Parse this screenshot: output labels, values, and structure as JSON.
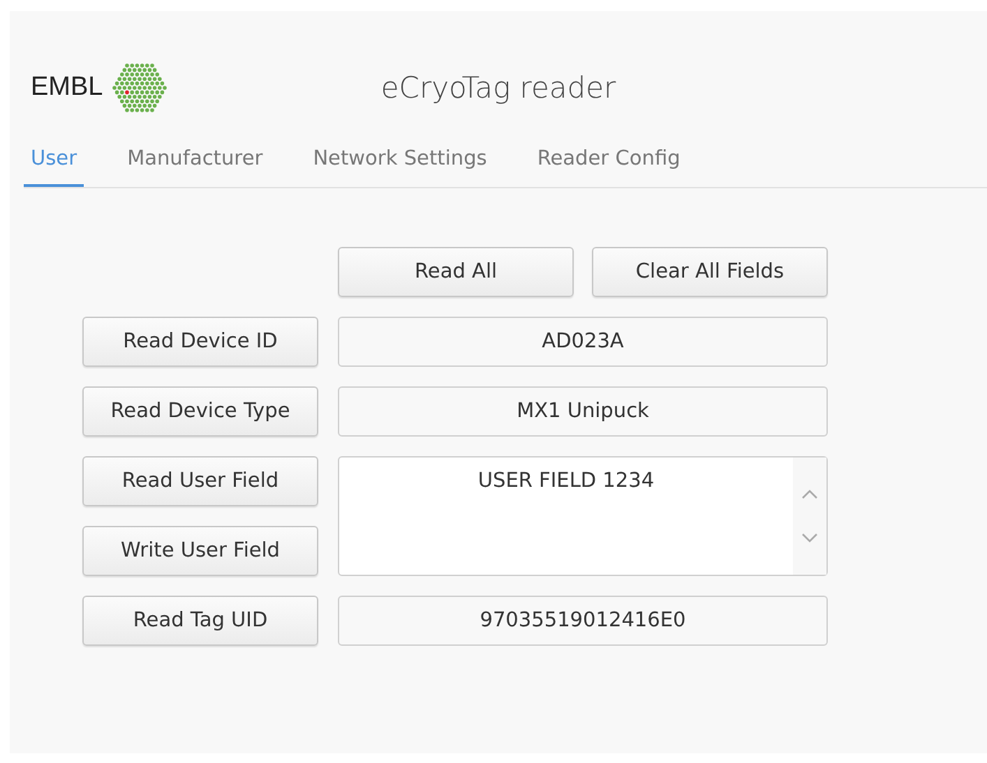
{
  "header": {
    "logo_text": "EMBL",
    "title": "eCryoTag reader"
  },
  "tabs": [
    {
      "label": "User",
      "selected": true
    },
    {
      "label": "Manufacturer",
      "selected": false
    },
    {
      "label": "Network Settings",
      "selected": false
    },
    {
      "label": "Reader Config",
      "selected": false
    }
  ],
  "actions": [
    "Read All",
    "Clear All Fields"
  ],
  "rows": [
    {
      "kind": "input",
      "buttons": [
        "Read Device ID"
      ],
      "value": "AD023A"
    },
    {
      "kind": "input",
      "buttons": [
        "Read Device Type"
      ],
      "value": "MX1 Unipuck"
    },
    {
      "kind": "textarea",
      "buttons": [
        "Read User Field",
        "Write User Field"
      ],
      "value": "USER FIELD 1234"
    },
    {
      "kind": "input",
      "buttons": [
        "Read Tag UID"
      ],
      "value": "97035519012416E0"
    }
  ]
}
